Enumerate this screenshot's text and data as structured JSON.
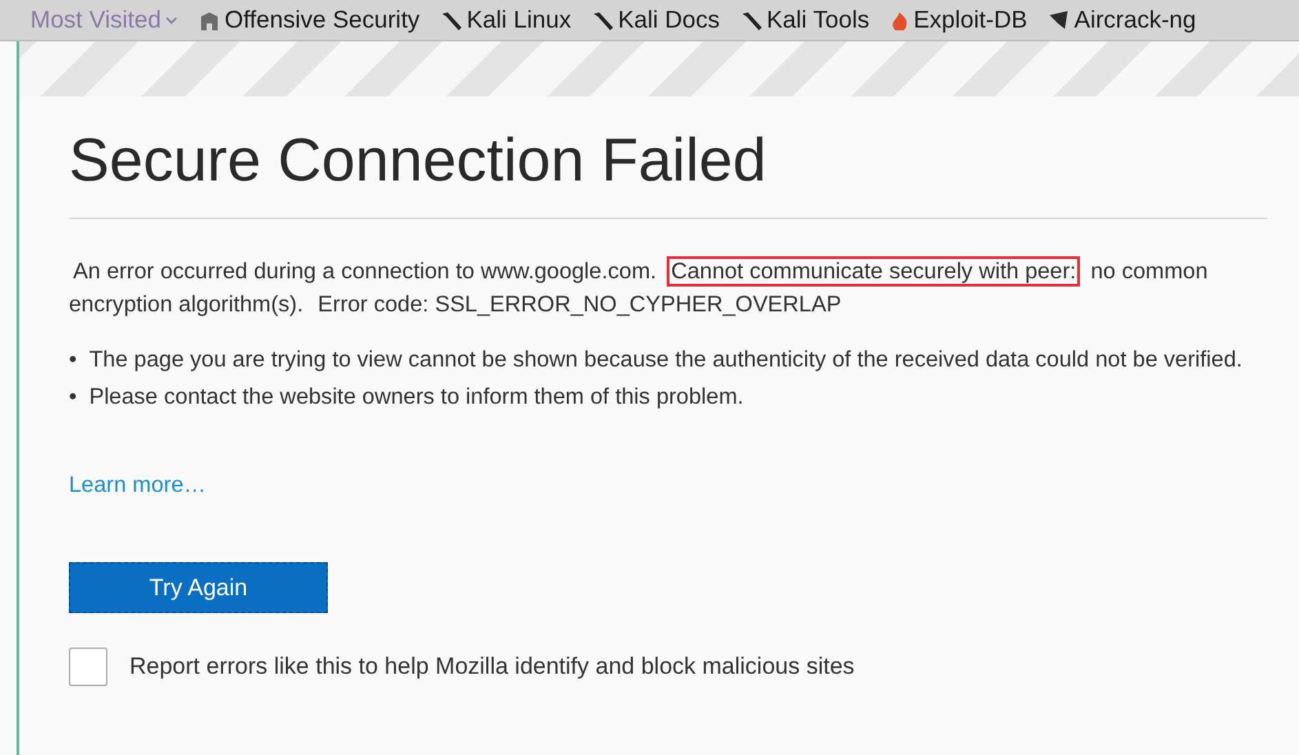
{
  "bookmarks_bar": [
    {
      "label": "Most Visited",
      "kind": "dropdown"
    },
    {
      "label": "Offensive Security",
      "kind": "building"
    },
    {
      "label": "Kali Linux",
      "kind": "dragon"
    },
    {
      "label": "Kali Docs",
      "kind": "dragon"
    },
    {
      "label": "Kali Tools",
      "kind": "dragon"
    },
    {
      "label": "Exploit-DB",
      "kind": "flame"
    },
    {
      "label": "Aircrack-ng",
      "kind": "wing"
    }
  ],
  "error_page": {
    "title": "Secure Connection Failed",
    "description": [
      {
        "text": "An error occurred during a connection to www.google.com.",
        "highlighted": false
      },
      {
        "text": "Cannot communicate securely with peer:",
        "highlighted": true
      },
      {
        "text": "no common encryption algorithm(s).",
        "highlighted": false
      },
      {
        "text": "Error code: SSL_ERROR_NO_CYPHER_OVERLAP",
        "highlighted": false
      }
    ],
    "bullets": [
      {
        "marker": "•",
        "text": "The page you are trying to view cannot be shown because the authenticity of the received data could not be verified."
      },
      {
        "marker": "•",
        "text": "Please contact the website owners to inform them of this problem."
      }
    ],
    "link": "Learn more…",
    "button": "Try Again",
    "report": {
      "label": "Report errors like this to help Mozilla identify and block malicious sites",
      "checked": false
    }
  }
}
